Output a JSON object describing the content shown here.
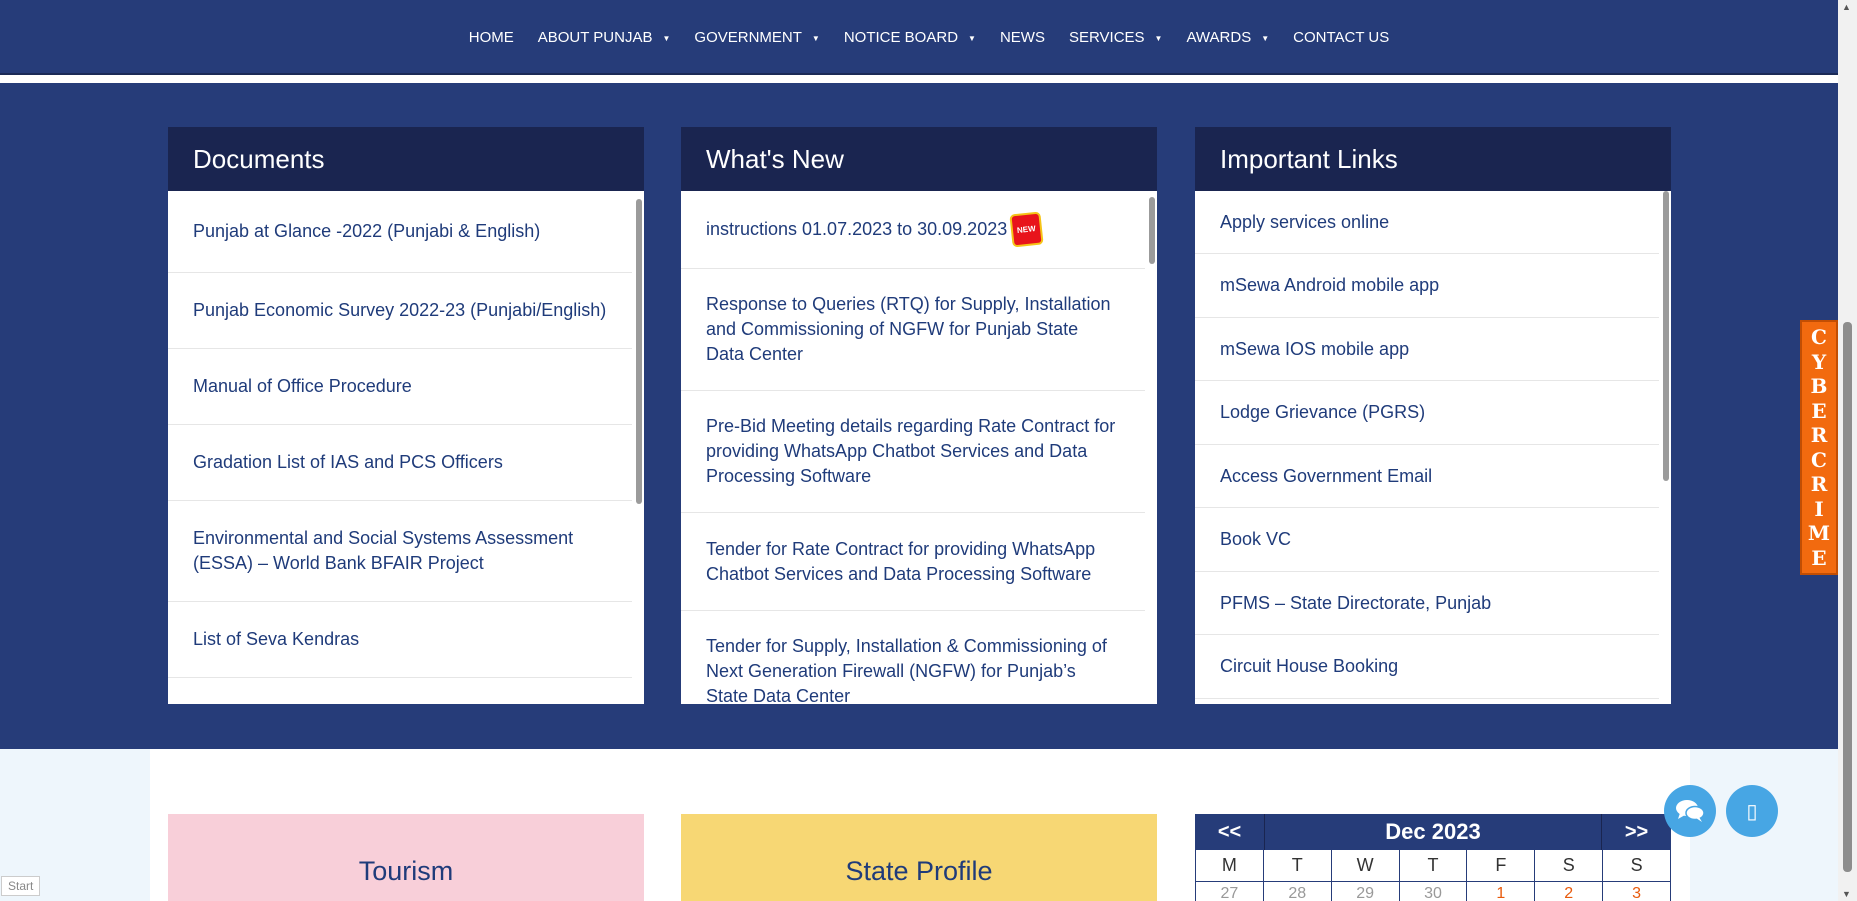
{
  "nav": {
    "items": [
      {
        "label": "HOME",
        "dropdown": false
      },
      {
        "label": "ABOUT PUNJAB",
        "dropdown": true
      },
      {
        "label": "GOVERNMENT",
        "dropdown": true
      },
      {
        "label": "NOTICE BOARD",
        "dropdown": true
      },
      {
        "label": "NEWS",
        "dropdown": false
      },
      {
        "label": "SERVICES",
        "dropdown": true
      },
      {
        "label": "AWARDS",
        "dropdown": true
      },
      {
        "label": "CONTACT US",
        "dropdown": false
      }
    ]
  },
  "documents": {
    "title": "Documents",
    "items": [
      "Punjab at Glance -2022 (Punjabi & English)",
      "Punjab Economic Survey 2022-23 (Punjabi/English)",
      "Manual of Office Procedure",
      "Gradation List of IAS and PCS Officers",
      "Environmental and Social Systems Assessment (ESSA) – World Bank BFAIR Project",
      "List of Seva Kendras"
    ]
  },
  "whats_new": {
    "title": "What's New",
    "new_badge": "NEW",
    "items": [
      "instructions 01.07.2023 to 30.09.2023",
      "Response to Queries (RTQ) for Supply, Installation and Commissioning of NGFW for Punjab State Data Center",
      "Pre-Bid Meeting details regarding Rate Contract for providing WhatsApp Chatbot Services and Data Processing Software",
      "Tender for Rate Contract for providing WhatsApp Chatbot Services and Data Processing Software",
      "Tender for Supply, Installation & Commissioning of Next Generation Firewall (NGFW) for Punjab’s State Data Center"
    ]
  },
  "important_links": {
    "title": "Important Links",
    "items": [
      "Apply services online",
      "mSewa Android mobile app",
      "mSewa IOS mobile app",
      "Lodge Grievance (PGRS)",
      "Access Government Email",
      "Book VC",
      "PFMS – State Directorate, Punjab",
      "Circuit House Booking"
    ]
  },
  "cards": {
    "tourism": "Tourism",
    "state_profile": "State Profile"
  },
  "calendar": {
    "prev": "<<",
    "next": ">>",
    "month": "Dec 2023",
    "days": [
      "M",
      "T",
      "W",
      "T",
      "F",
      "S",
      "S"
    ],
    "first_row": [
      "27",
      "28",
      "29",
      "30",
      "1",
      "2",
      "3"
    ]
  },
  "cyber_crime": [
    "C",
    "Y",
    "B",
    "E",
    "R",
    "C",
    "R",
    "I",
    "M",
    "E"
  ],
  "start_label": "Start",
  "colors": {
    "nav_bg": "#263c79",
    "panel_head": "#1a2550",
    "link_text": "#1f3b7a",
    "cyber_tab": "#f26a0f",
    "fab": "#47a6e4",
    "tourism_card": "#f8cfd9",
    "profile_card": "#f7d774"
  },
  "icons": {
    "chat": "chat-bubbles-icon",
    "other": "accessibility-icon"
  }
}
